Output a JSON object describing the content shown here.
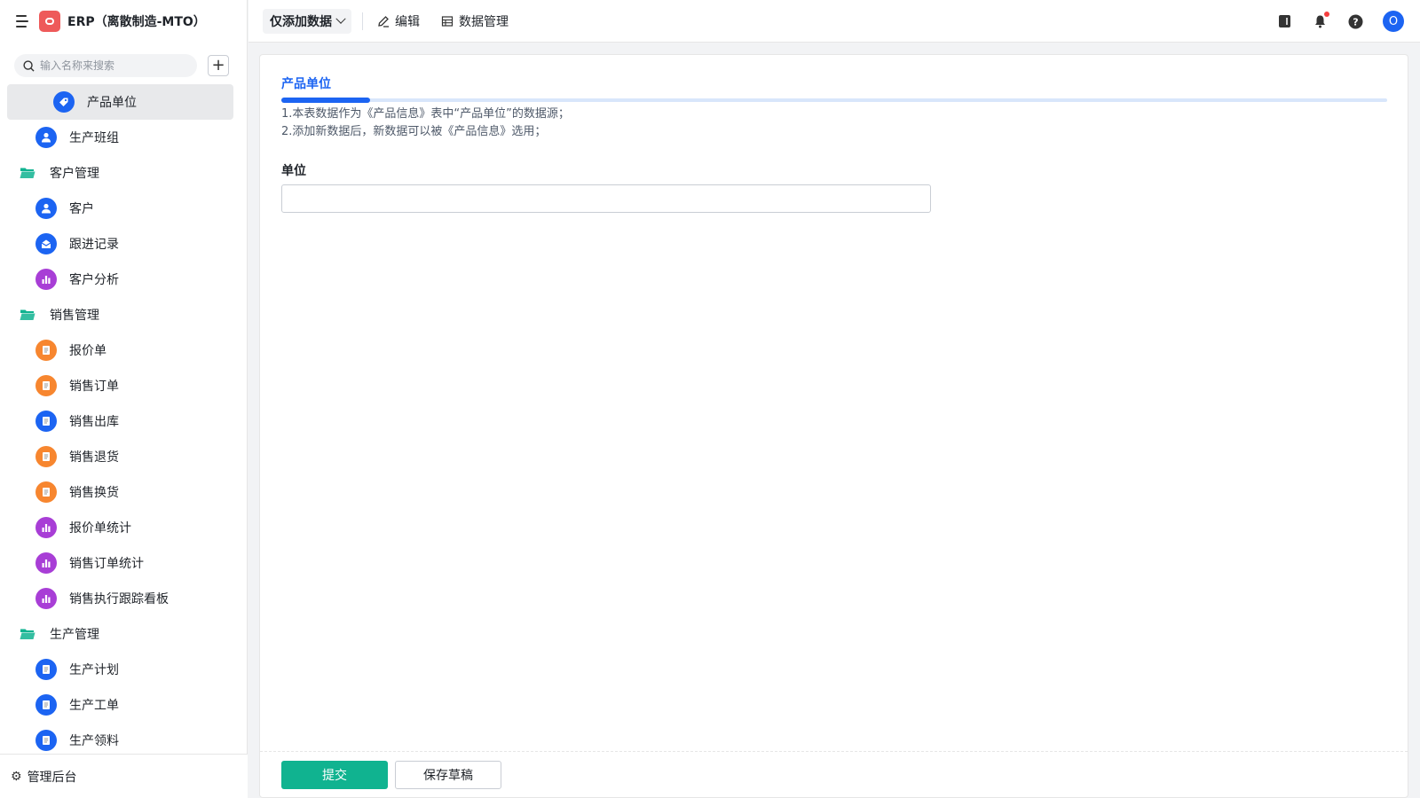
{
  "app": {
    "title": "ERP（离散制造-MTO）"
  },
  "sidebar": {
    "search_placeholder": "输入名称来搜索",
    "footer_label": "管理后台",
    "items": [
      {
        "label": "产品单位",
        "kind": "leaf",
        "icon": "tag-icon",
        "color": "#1c64f2",
        "active": true
      },
      {
        "label": "生产班组",
        "kind": "leaf",
        "icon": "person-icon",
        "color": "#1c64f2"
      },
      {
        "label": "客户管理",
        "kind": "folder",
        "icon": "folder-icon",
        "color": "#10b390"
      },
      {
        "label": "客户",
        "kind": "leaf",
        "icon": "person-icon",
        "color": "#1c64f2"
      },
      {
        "label": "跟进记录",
        "kind": "leaf",
        "icon": "inbox-icon",
        "color": "#1c64f2"
      },
      {
        "label": "客户分析",
        "kind": "leaf",
        "icon": "bar-chart-icon",
        "color": "#a83ed6"
      },
      {
        "label": "销售管理",
        "kind": "folder",
        "icon": "folder-icon",
        "color": "#10b390"
      },
      {
        "label": "报价单",
        "kind": "leaf",
        "icon": "document-icon",
        "color": "#f7862f"
      },
      {
        "label": "销售订单",
        "kind": "leaf",
        "icon": "document-icon",
        "color": "#f7862f"
      },
      {
        "label": "销售出库",
        "kind": "leaf",
        "icon": "document-icon",
        "color": "#1c64f2"
      },
      {
        "label": "销售退货",
        "kind": "leaf",
        "icon": "document-icon",
        "color": "#f7862f"
      },
      {
        "label": "销售换货",
        "kind": "leaf",
        "icon": "document-icon",
        "color": "#f7862f"
      },
      {
        "label": "报价单统计",
        "kind": "leaf",
        "icon": "bar-chart-icon",
        "color": "#a83ed6"
      },
      {
        "label": "销售订单统计",
        "kind": "leaf",
        "icon": "bar-chart-icon",
        "color": "#a83ed6"
      },
      {
        "label": "销售执行跟踪看板",
        "kind": "leaf",
        "icon": "bar-chart-icon",
        "color": "#a83ed6"
      },
      {
        "label": "生产管理",
        "kind": "folder",
        "icon": "folder-icon",
        "color": "#10b390"
      },
      {
        "label": "生产计划",
        "kind": "leaf",
        "icon": "document-icon",
        "color": "#1c64f2"
      },
      {
        "label": "生产工单",
        "kind": "leaf",
        "icon": "document-icon",
        "color": "#1c64f2"
      },
      {
        "label": "生产领料",
        "kind": "leaf",
        "icon": "document-icon",
        "color": "#1c64f2"
      }
    ]
  },
  "toolbar": {
    "mode_label": "仅添加数据",
    "edit_label": "编辑",
    "data_manage_label": "数据管理",
    "avatar_initial": "O"
  },
  "form": {
    "title": "产品单位",
    "progress_percent": 8,
    "desc_line1": "1.本表数据作为《产品信息》表中“产品单位”的数据源；",
    "desc_line2": "2.添加新数据后，新数据可以被《产品信息》选用；",
    "field_label": "单位",
    "field_value": "",
    "submit_label": "提交",
    "draft_label": "保存草稿"
  },
  "colors": {
    "brand_blue": "#1c64f2",
    "submit_green": "#10b390",
    "folder_green": "#10b390"
  }
}
